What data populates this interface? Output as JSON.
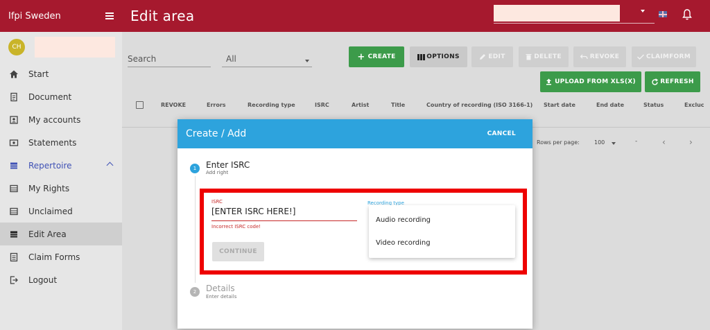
{
  "topbar": {
    "brand": "Ifpi Sweden",
    "title": "Edit area"
  },
  "sidebar": {
    "avatar_initials": "CH",
    "items": [
      {
        "label": "Start",
        "icon": "home-icon"
      },
      {
        "label": "Document",
        "icon": "document-icon"
      },
      {
        "label": "My accounts",
        "icon": "accounts-icon"
      },
      {
        "label": "Statements",
        "icon": "statements-icon"
      },
      {
        "label": "Repertoire",
        "icon": "repertoire-icon"
      },
      {
        "label": "My Rights",
        "icon": "list-icon"
      },
      {
        "label": "Unclaimed",
        "icon": "list-icon"
      },
      {
        "label": "Edit Area",
        "icon": "list-icon"
      },
      {
        "label": "Claim Forms",
        "icon": "form-icon"
      },
      {
        "label": "Logout",
        "icon": "logout-icon"
      }
    ]
  },
  "toolbar": {
    "search_label": "Search",
    "filter_value": "All",
    "create": "CREATE",
    "options": "OPTIONS",
    "edit": "EDIT",
    "delete": "DELETE",
    "revoke": "REVOKE",
    "claimform": "CLAIMFORM",
    "upload": "UPLOAD FROM XLS(X)",
    "refresh": "REFRESH"
  },
  "table": {
    "columns": [
      "REVOKE",
      "Errors",
      "Recording type",
      "ISRC",
      "Artist",
      "Title",
      "Country of recording (ISO 3166-1)",
      "Start date",
      "End date",
      "Status",
      "Excluc"
    ]
  },
  "pager": {
    "label": "Rows per page:",
    "value": "100",
    "range": "-",
    "prev": "‹",
    "next": "›"
  },
  "modal": {
    "title": "Create / Add",
    "cancel": "CANCEL",
    "step1": {
      "number": "1",
      "title": "Enter ISRC",
      "subtitle": "Add right"
    },
    "step2": {
      "number": "2",
      "title": "Details",
      "subtitle": "Enter details"
    },
    "isrc_label": "ISRC",
    "isrc_value": "[ENTER ISRC HERE!]",
    "isrc_error": "Incorrect ISRC code!",
    "recording_type_label": "Recording type",
    "continue": "CONTINUE",
    "recording_type_options": [
      "Audio recording",
      "Video recording"
    ]
  },
  "colors": {
    "topbar": "#a6192e",
    "modal_header": "#2da3dd",
    "create_button": "#3c9b4a",
    "error": "#c62828",
    "highlight": "#ee0000"
  }
}
